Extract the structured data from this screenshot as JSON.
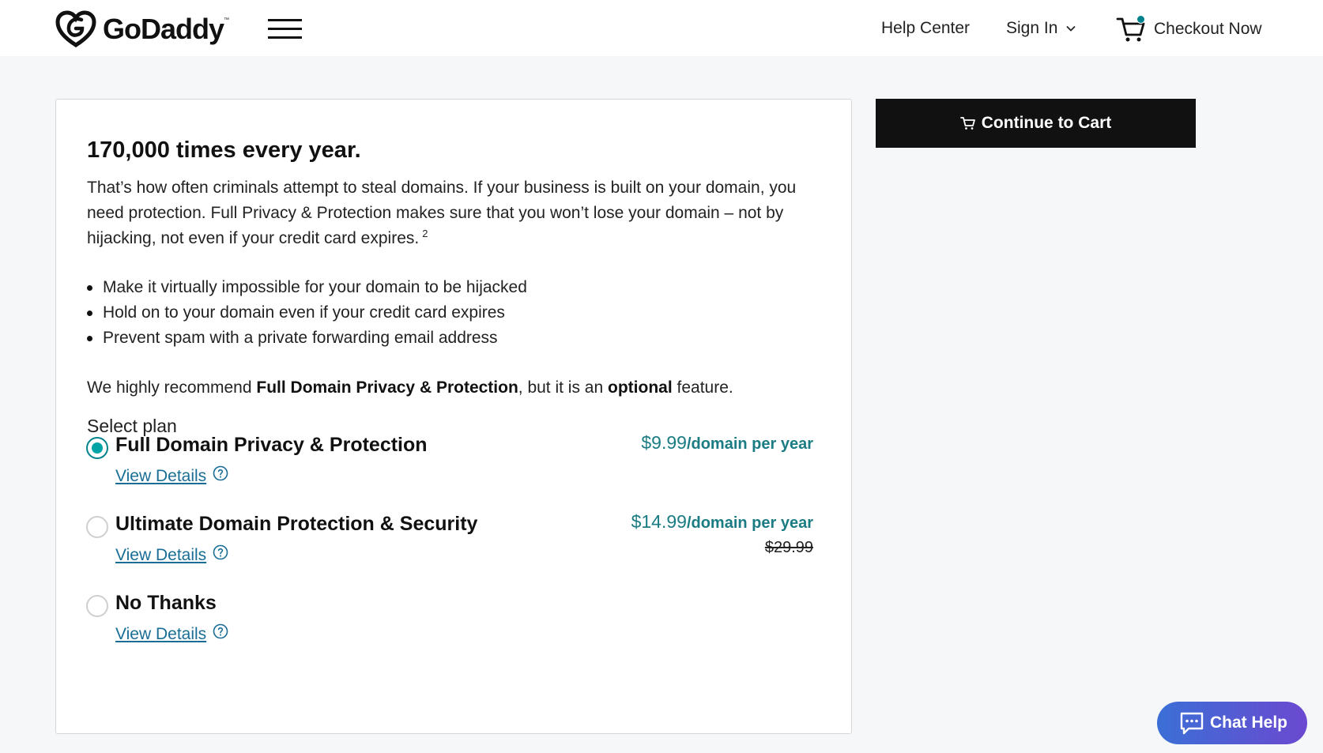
{
  "header": {
    "brand": "GoDaddy",
    "brand_tm": "™",
    "help_center": "Help Center",
    "sign_in": "Sign In",
    "checkout": "Checkout Now"
  },
  "content": {
    "headline": "170,000 times every year.",
    "intro": "That’s how often criminals attempt to steal domains. If your business is built on your domain, you need protection. Full Privacy & Protection makes sure that you won’t lose your domain – not by hijacking, not even if your credit card expires.",
    "intro_footnote": "2",
    "bullets": [
      "Make it virtually impossible for your domain to be hijacked",
      "Hold on to your domain even if your credit card expires",
      "Prevent spam with a private forwarding email address"
    ],
    "recommend": {
      "prefix": "We highly recommend ",
      "product": "Full Domain Privacy & Protection",
      "middle": ", but it is an ",
      "optional": "optional",
      "suffix": " feature."
    },
    "select_plan": "Select plan",
    "plans": [
      {
        "name": "Full Domain Privacy & Protection",
        "price": "$9.99",
        "per": "/domain per year",
        "original_price": "",
        "details": "View Details",
        "selected": true
      },
      {
        "name": "Ultimate Domain Protection & Security",
        "price": "$14.99",
        "per": "/domain per year",
        "original_price": "$29.99",
        "details": "View Details",
        "selected": false
      },
      {
        "name": "No Thanks",
        "price": "",
        "per": "",
        "original_price": "",
        "details": "View Details",
        "selected": false
      }
    ]
  },
  "sidebar": {
    "continue_label": "Continue to Cart"
  },
  "chat": {
    "label": "Chat Help"
  },
  "colors": {
    "accent": "#00838c",
    "price": "#1b7c83",
    "link": "#1a6d95",
    "chat_gradient_start": "#3b6fd6",
    "chat_gradient_end": "#6b49d0"
  },
  "icons": [
    "godaddy-logo-icon",
    "hamburger-menu-icon",
    "chevron-down-icon",
    "cart-icon",
    "help-circle-icon",
    "chat-icon"
  ]
}
